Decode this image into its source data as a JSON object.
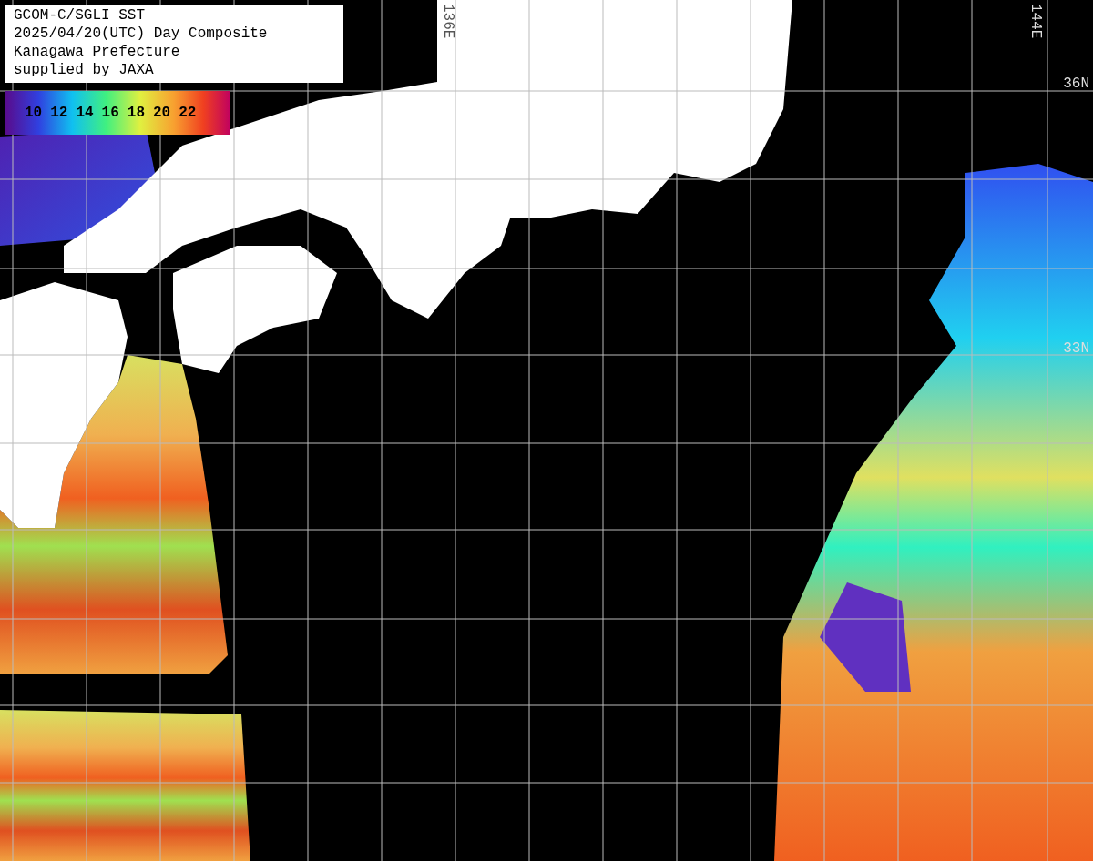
{
  "info": {
    "lines": [
      "GCOM-C/SGLI SST",
      "2025/04/20(UTC) Day Composite",
      "Kanagawa Prefecture",
      "supplied by JAXA"
    ]
  },
  "legend": {
    "ticks": [
      "10",
      "12",
      "14",
      "16",
      "18",
      "20",
      "22"
    ]
  },
  "map": {
    "longitude_labels": [
      "136E",
      "144E"
    ],
    "latitude_labels": [
      "36N",
      "33N"
    ]
  }
}
